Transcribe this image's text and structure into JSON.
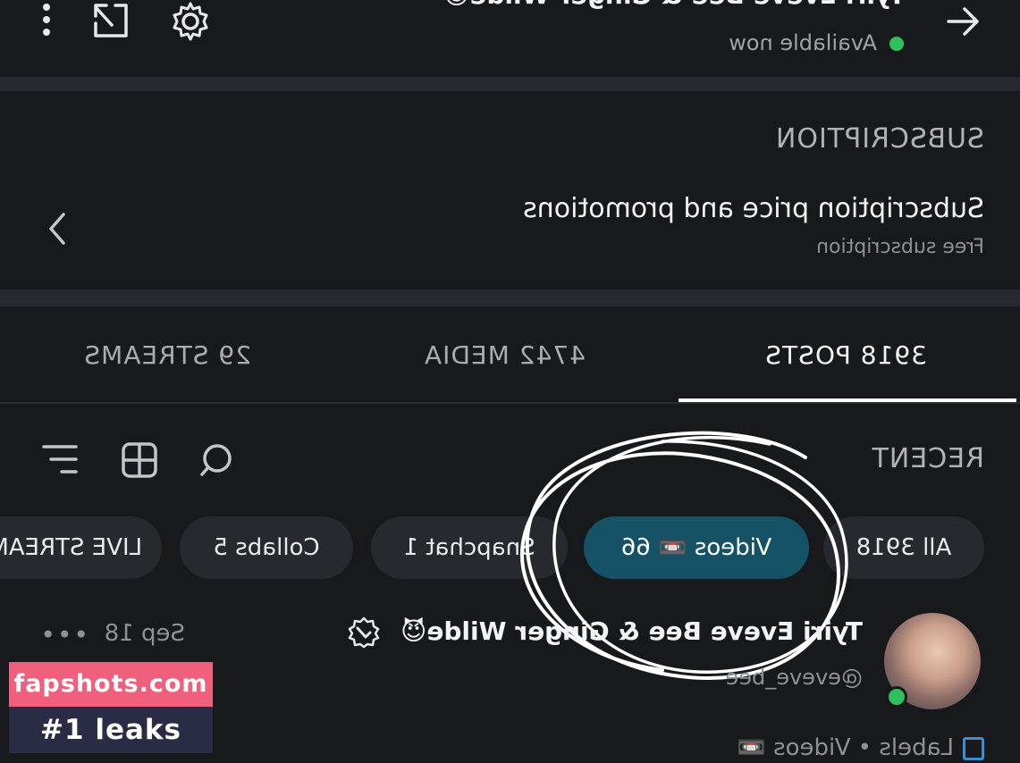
{
  "header": {
    "title": "Tyiri Eveve Bee & Ginger Wilde😈",
    "status": "Available now"
  },
  "subscription": {
    "section_label": "SUBSCRIPTION",
    "title": "Subscription price and promotions",
    "description": "Free subscription"
  },
  "tabs": [
    {
      "label": "3918 POSTS",
      "active": true
    },
    {
      "label": "4742 MEDIA",
      "active": false
    },
    {
      "label": "29 STREAMS",
      "active": false
    }
  ],
  "filters": {
    "label": "RECENT",
    "chips": [
      {
        "label": "All 3918",
        "selected": false
      },
      {
        "label": "Videos 📼 66",
        "selected": true
      },
      {
        "label": "Snapchat 1",
        "selected": false
      },
      {
        "label": "Collabs 5",
        "selected": false
      },
      {
        "label": "LIVE STREAMS",
        "selected": false
      }
    ]
  },
  "post": {
    "author": "Tyiri Eveve Bee & Ginger Wilde😈",
    "handle": "@eveve_bee",
    "date": "Sep 18",
    "more": "•••",
    "labels": "Labels • Videos 📼"
  },
  "watermark": {
    "site": "fapshots.com",
    "tagline": "#1 leaks"
  },
  "colors": {
    "background": "#17191c",
    "selected_chip": "#155266",
    "online": "#2fbf5b",
    "watermark_pink": "#f0607c",
    "watermark_navy": "#2a2c45"
  }
}
